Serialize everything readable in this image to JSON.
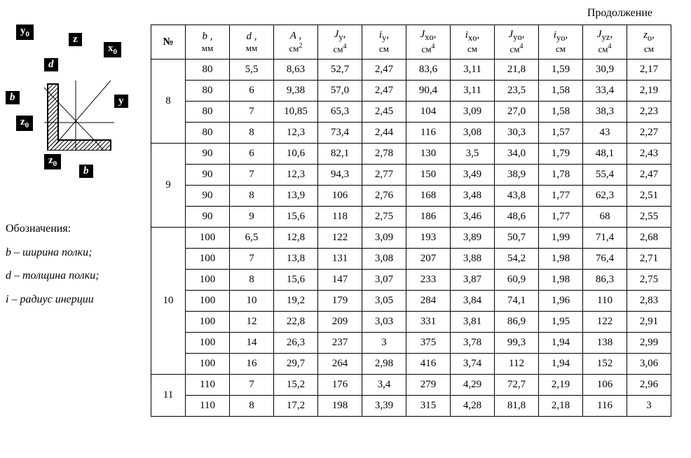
{
  "continuation": "Продолжение",
  "diagram_labels": {
    "y0_top": "y",
    "y0_top_sub": "0",
    "z_top": "z",
    "x0": "x",
    "x0_sub": "0",
    "d": "d",
    "b_left": "b",
    "y_right": "y",
    "z0_left": "z",
    "z0_left_sub": "0",
    "z0_bottom": "z",
    "z0_bottom_sub": "0",
    "b_bottom": "b"
  },
  "notes": {
    "n1": "Обозначения:",
    "n2": "b – ширина полки;",
    "n3": "d – толщина полки;",
    "n4": "i – радиус инерции"
  },
  "headers": {
    "num": "№",
    "b": {
      "sym": "b ,",
      "unit": "мм"
    },
    "d": {
      "sym": "d ,",
      "unit": "мм"
    },
    "A": {
      "sym": "A ,",
      "unit": "см",
      "sup": "2"
    },
    "Jy": {
      "sym": "J",
      "sub": "y",
      "tail": ",",
      "unit": "см",
      "sup": "4"
    },
    "iy": {
      "sym": "i",
      "sub": "y",
      "tail": ",",
      "unit": "см"
    },
    "Jxo": {
      "sym": "J",
      "sub": "xo",
      "tail": ",",
      "unit": "см",
      "sup": "4"
    },
    "ixo": {
      "sym": "i",
      "sub": "xo",
      "tail": ",",
      "unit": "см"
    },
    "Jyo": {
      "sym": "J",
      "sub": "yo",
      "tail": ",",
      "unit": "см",
      "sup": "4"
    },
    "iyo": {
      "sym": "i",
      "sub": "yo",
      "tail": ",",
      "unit": "см"
    },
    "Jyz": {
      "sym": "J",
      "sub": "yz",
      "tail": ",",
      "unit": "см",
      "sup": "4"
    },
    "zo": {
      "sym": "z",
      "sub": "o",
      "tail": ",",
      "unit": "см"
    }
  },
  "groups": [
    {
      "num": "8",
      "rows": [
        {
          "b": "80",
          "d": "5,5",
          "A": "8,63",
          "Jy": "52,7",
          "iy": "2,47",
          "Jxo": "83,6",
          "ixo": "3,11",
          "Jyo": "21,8",
          "iyo": "1,59",
          "Jyz": "30,9",
          "zo": "2,17"
        },
        {
          "b": "80",
          "d": "6",
          "A": "9,38",
          "Jy": "57,0",
          "iy": "2,47",
          "Jxo": "90,4",
          "ixo": "3,11",
          "Jyo": "23,5",
          "iyo": "1,58",
          "Jyz": "33,4",
          "zo": "2,19"
        },
        {
          "b": "80",
          "d": "7",
          "A": "10,85",
          "Jy": "65,3",
          "iy": "2,45",
          "Jxo": "104",
          "ixo": "3,09",
          "Jyo": "27,0",
          "iyo": "1,58",
          "Jyz": "38,3",
          "zo": "2,23"
        },
        {
          "b": "80",
          "d": "8",
          "A": "12,3",
          "Jy": "73,4",
          "iy": "2,44",
          "Jxo": "116",
          "ixo": "3,08",
          "Jyo": "30,3",
          "iyo": "1,57",
          "Jyz": "43",
          "zo": "2,27"
        }
      ]
    },
    {
      "num": "9",
      "rows": [
        {
          "b": "90",
          "d": "6",
          "A": "10,6",
          "Jy": "82,1",
          "iy": "2,78",
          "Jxo": "130",
          "ixo": "3,5",
          "Jyo": "34,0",
          "iyo": "1,79",
          "Jyz": "48,1",
          "zo": "2,43"
        },
        {
          "b": "90",
          "d": "7",
          "A": "12,3",
          "Jy": "94,3",
          "iy": "2,77",
          "Jxo": "150",
          "ixo": "3,49",
          "Jyo": "38,9",
          "iyo": "1,78",
          "Jyz": "55,4",
          "zo": "2,47"
        },
        {
          "b": "90",
          "d": "8",
          "A": "13,9",
          "Jy": "106",
          "iy": "2,76",
          "Jxo": "168",
          "ixo": "3,48",
          "Jyo": "43,8",
          "iyo": "1,77",
          "Jyz": "62,3",
          "zo": "2,51"
        },
        {
          "b": "90",
          "d": "9",
          "A": "15,6",
          "Jy": "118",
          "iy": "2,75",
          "Jxo": "186",
          "ixo": "3,46",
          "Jyo": "48,6",
          "iyo": "1,77",
          "Jyz": "68",
          "zo": "2,55"
        }
      ]
    },
    {
      "num": "10",
      "rows": [
        {
          "b": "100",
          "d": "6,5",
          "A": "12,8",
          "Jy": "122",
          "iy": "3,09",
          "Jxo": "193",
          "ixo": "3,89",
          "Jyo": "50,7",
          "iyo": "1,99",
          "Jyz": "71,4",
          "zo": "2,68"
        },
        {
          "b": "100",
          "d": "7",
          "A": "13,8",
          "Jy": "131",
          "iy": "3,08",
          "Jxo": "207",
          "ixo": "3,88",
          "Jyo": "54,2",
          "iyo": "1,98",
          "Jyz": "76,4",
          "zo": "2,71"
        },
        {
          "b": "100",
          "d": "8",
          "A": "15,6",
          "Jy": "147",
          "iy": "3,07",
          "Jxo": "233",
          "ixo": "3,87",
          "Jyo": "60,9",
          "iyo": "1,98",
          "Jyz": "86,3",
          "zo": "2,75"
        },
        {
          "b": "100",
          "d": "10",
          "A": "19,2",
          "Jy": "179",
          "iy": "3,05",
          "Jxo": "284",
          "ixo": "3,84",
          "Jyo": "74,1",
          "iyo": "1,96",
          "Jyz": "110",
          "zo": "2,83"
        },
        {
          "b": "100",
          "d": "12",
          "A": "22,8",
          "Jy": "209",
          "iy": "3,03",
          "Jxo": "331",
          "ixo": "3,81",
          "Jyo": "86,9",
          "iyo": "1,95",
          "Jyz": "122",
          "zo": "2,91"
        },
        {
          "b": "100",
          "d": "14",
          "A": "26,3",
          "Jy": "237",
          "iy": "3",
          "Jxo": "375",
          "ixo": "3,78",
          "Jyo": "99,3",
          "iyo": "1,94",
          "Jyz": "138",
          "zo": "2,99"
        },
        {
          "b": "100",
          "d": "16",
          "A": "29,7",
          "Jy": "264",
          "iy": "2,98",
          "Jxo": "416",
          "ixo": "3,74",
          "Jyo": "112",
          "iyo": "1,94",
          "Jyz": "152",
          "zo": "3,06"
        }
      ]
    },
    {
      "num": "11",
      "rows": [
        {
          "b": "110",
          "d": "7",
          "A": "15,2",
          "Jy": "176",
          "iy": "3,4",
          "Jxo": "279",
          "ixo": "4,29",
          "Jyo": "72,7",
          "iyo": "2,19",
          "Jyz": "106",
          "zo": "2,96"
        },
        {
          "b": "110",
          "d": "8",
          "A": "17,2",
          "Jy": "198",
          "iy": "3,39",
          "Jxo": "315",
          "ixo": "4,28",
          "Jyo": "81,8",
          "iyo": "2,18",
          "Jyz": "116",
          "zo": "3"
        }
      ]
    }
  ]
}
